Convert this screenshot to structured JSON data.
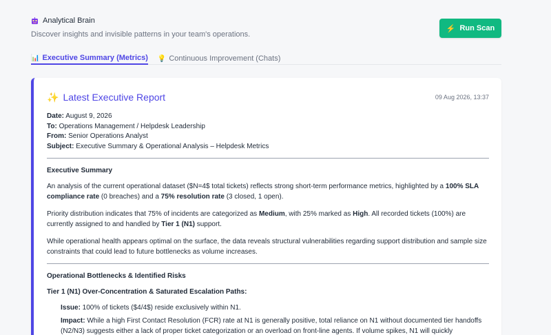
{
  "header": {
    "brand_icon": "brain-robot-icon",
    "brand_title": "Analytical Brain",
    "subtitle": "Discover insights and invisible patterns in your team's operations.",
    "run_scan_label": "Run Scan",
    "run_scan_icon": "⚡"
  },
  "tabs": [
    {
      "icon": "📊",
      "label": "Executive Summary (Metrics)",
      "active": true
    },
    {
      "icon": "💡",
      "label": "Continuous Improvement (Chats)",
      "active": false
    }
  ],
  "report": {
    "title_icon": "✨",
    "title": "Latest Executive Report",
    "timestamp": "09 Aug 2026, 13:37",
    "meta": {
      "date_label": "Date:",
      "date_value": "August 9, 2026",
      "to_label": "To:",
      "to_value": "Operations Management / Helpdesk Leadership",
      "from_label": "From:",
      "from_value": "Senior Operations Analyst",
      "subject_label": "Subject:",
      "subject_value": "Executive Summary & Operational Analysis – Helpdesk Metrics"
    },
    "exec_summary": {
      "heading": "Executive Summary",
      "p1_a": "An analysis of the current operational dataset ($N=4$ total tickets) reflects strong short-term performance metrics, highlighted by a ",
      "p1_b1": "100% SLA compliance rate",
      "p1_c": " (0 breaches) and a ",
      "p1_b2": "75% resolution rate",
      "p1_d": " (3 closed, 1 open).",
      "p2_a": "Priority distribution indicates that 75% of incidents are categorized as ",
      "p2_b1": "Medium",
      "p2_c": ", with 25% marked as ",
      "p2_b2": "High",
      "p2_d": ". All recorded tickets (100%) are currently assigned to and handled by ",
      "p2_b3": "Tier 1 (N1)",
      "p2_e": " support.",
      "p3": "While operational health appears optimal on the surface, the data reveals structural vulnerabilities regarding support distribution and sample size constraints that could lead to future bottlenecks as volume increases."
    },
    "bottlenecks": {
      "heading": "Operational Bottlenecks & Identified Risks",
      "sub_heading": "Tier 1 (N1) Over-Concentration & Saturated Escalation Paths:",
      "issue_label": "Issue:",
      "issue_text": " 100% of tickets ($4/4$) reside exclusively within N1.",
      "impact_label": "Impact:",
      "impact_text": " While a high First Contact Resolution (FCR) rate at N1 is generally positive, total reliance on N1 without documented tier handoffs (N2/N3) suggests either a lack of proper ticket categorization or an overload on front-line agents. If volume spikes, N1 will quickly"
    }
  }
}
